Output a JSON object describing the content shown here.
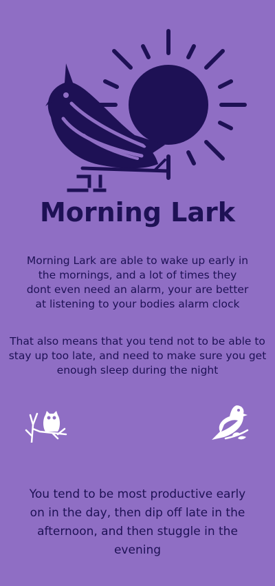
{
  "colors": {
    "background": "#8f6ec4",
    "ink": "#1e1155",
    "icon": "#ffffff"
  },
  "header": {
    "sun_icon": "sun-icon",
    "bird_icon": "lark-bird-icon",
    "title": "Morning Lark"
  },
  "body": {
    "paragraph_1": "Morning Lark are able to wake up early in the mornings, and a lot of times they dont even need an alarm, your are better at listening to your bodies alarm clock",
    "paragraph_2": "That also means that  you tend not to be able to stay up too late, and need to make sure you get enough sleep during the night",
    "paragraph_3": "You tend to be most productive early on in the day, then dip off late in the afternoon, and then stuggle in the evening"
  },
  "icons": {
    "left": "owl-on-branch-icon",
    "right": "bird-on-branch-icon"
  }
}
